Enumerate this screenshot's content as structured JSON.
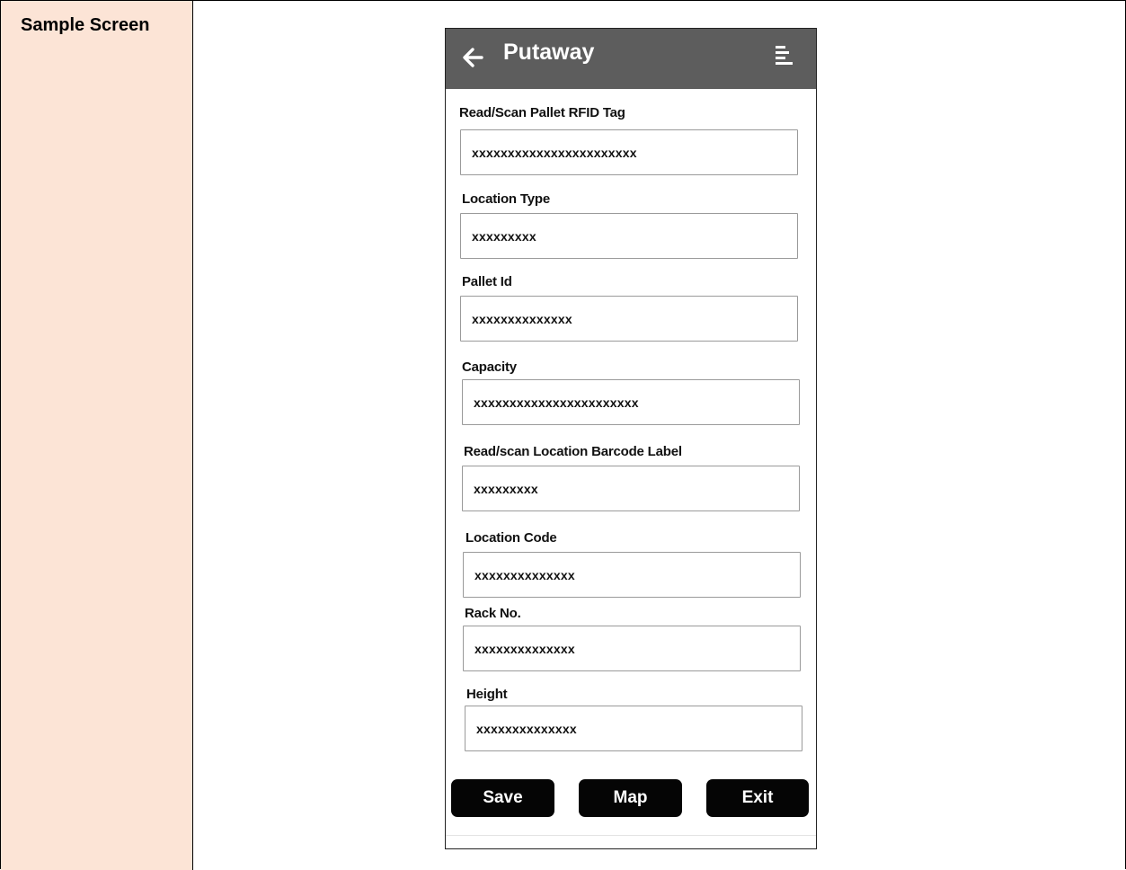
{
  "document": {
    "section_label": "Sample Screen"
  },
  "app": {
    "title": "Putaway"
  },
  "icons": {
    "back": "arrow-left-icon",
    "menu": "menu-lines-icon"
  },
  "colors": {
    "label_cell_bg": "#fce4d6",
    "appbar_bg": "#5d5d5d",
    "button_bg": "#050505"
  },
  "fields": [
    {
      "label": "Read/Scan Pallet RFID Tag",
      "value": "xxxxxxxxxxxxxxxxxxxxxxx"
    },
    {
      "label": "Location Type",
      "value": "xxxxxxxxx"
    },
    {
      "label": "Pallet Id",
      "value": "xxxxxxxxxxxxxx"
    },
    {
      "label": "Capacity",
      "value": "xxxxxxxxxxxxxxxxxxxxxxx"
    },
    {
      "label": "Read/scan Location Barcode Label",
      "value": "xxxxxxxxx"
    },
    {
      "label": "Location Code",
      "value": "xxxxxxxxxxxxxx"
    },
    {
      "label": "Rack No.",
      "value": "xxxxxxxxxxxxxx"
    },
    {
      "label": "Height",
      "value": "xxxxxxxxxxxxxx"
    }
  ],
  "buttons": {
    "save": "Save",
    "map": "Map",
    "exit": "Exit"
  }
}
